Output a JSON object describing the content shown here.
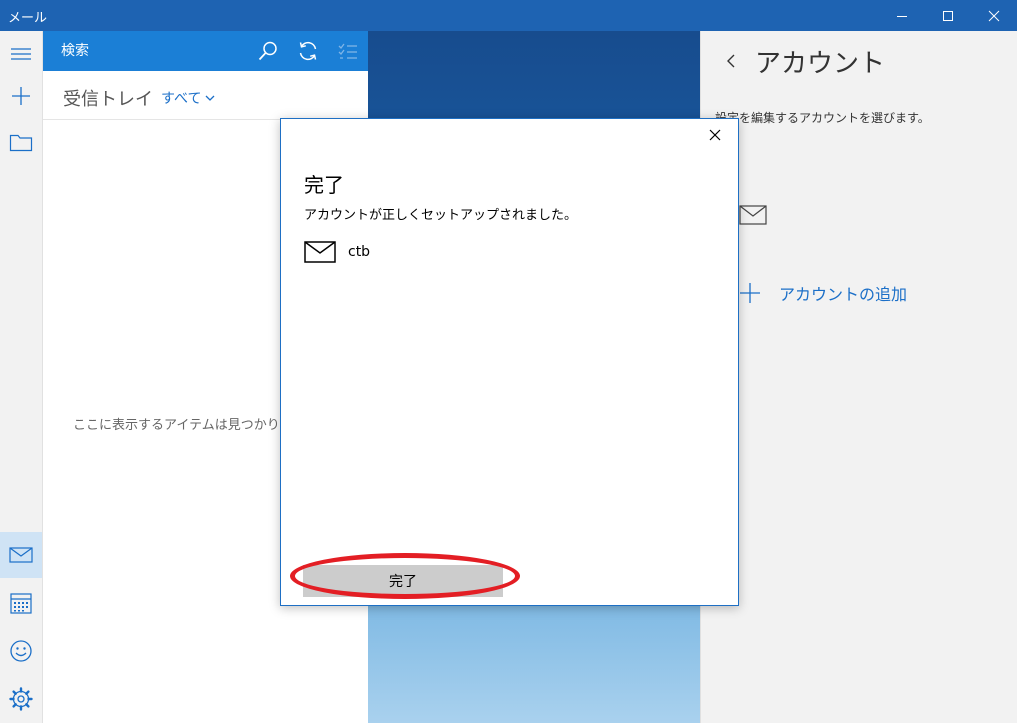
{
  "window": {
    "title": "メール"
  },
  "search": {
    "placeholder": "検索"
  },
  "folder": {
    "name": "受信トレイ",
    "filter": "すべて"
  },
  "message_list": {
    "empty_text": "ここに表示するアイテムは見つかりませ"
  },
  "account_pane": {
    "title": "アカウント",
    "description": "設定を編集するアカウントを選びます。",
    "add_account": "アカウントの追加"
  },
  "dialog": {
    "title": "完了",
    "message": "アカウントが正しくセットアップされました。",
    "account_name": "ctb",
    "done_label": "完了"
  },
  "colors": {
    "titlebar": "#1e63b2",
    "searchbar": "#1b7fd6",
    "accent": "#1b6fc8",
    "highlight": "#e31e24"
  }
}
